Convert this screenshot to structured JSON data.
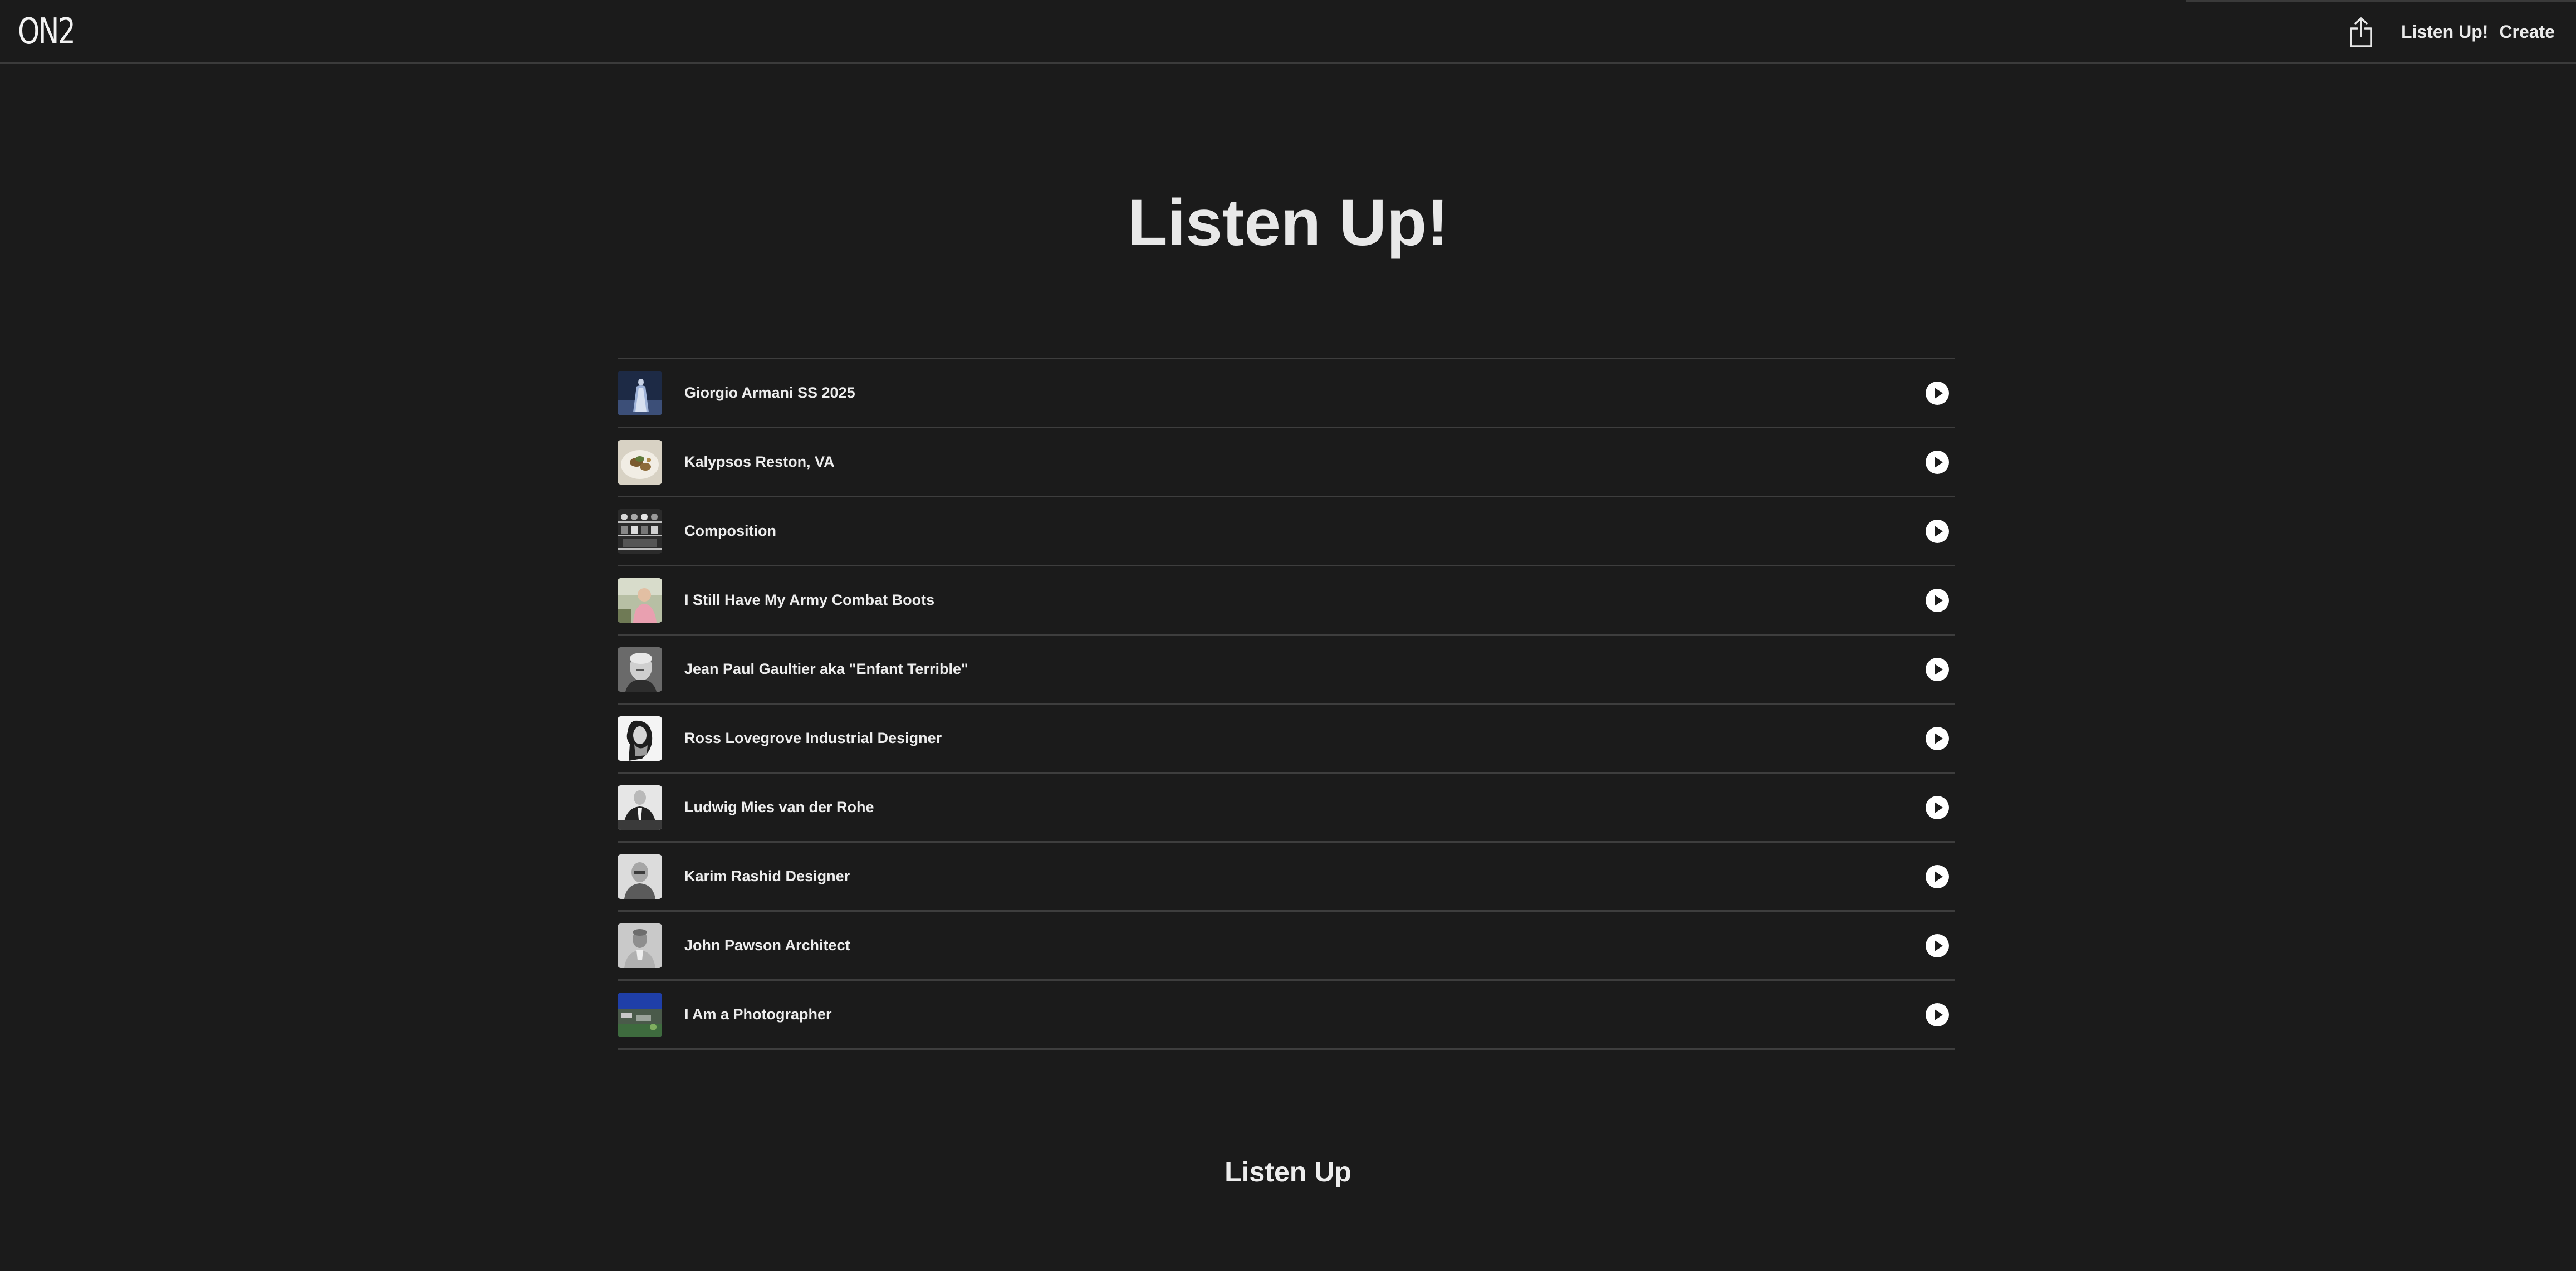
{
  "header": {
    "logo": "ON2",
    "nav": [
      {
        "label": "Listen Up!"
      },
      {
        "label": "Create"
      }
    ]
  },
  "page": {
    "title": "Listen Up!",
    "footer_title": "Listen Up"
  },
  "tracks": [
    {
      "title": "Giorgio Armani SS 2025",
      "thumb": "runway"
    },
    {
      "title": "Kalypsos Reston, VA",
      "thumb": "food"
    },
    {
      "title": "Composition",
      "thumb": "shelves"
    },
    {
      "title": "I Still Have My Army Combat Boots",
      "thumb": "portrait-color"
    },
    {
      "title": "Jean Paul Gaultier aka \"Enfant Terrible\"",
      "thumb": "portrait-bw"
    },
    {
      "title": "Ross Lovegrove Industrial Designer",
      "thumb": "profile-bw"
    },
    {
      "title": "Ludwig Mies van der Rohe",
      "thumb": "suit-bw"
    },
    {
      "title": "Karim Rashid Designer",
      "thumb": "portrait-light"
    },
    {
      "title": "John Pawson Architect",
      "thumb": "portrait-gray"
    },
    {
      "title": "I Am a Photographer",
      "thumb": "landscape"
    }
  ]
}
